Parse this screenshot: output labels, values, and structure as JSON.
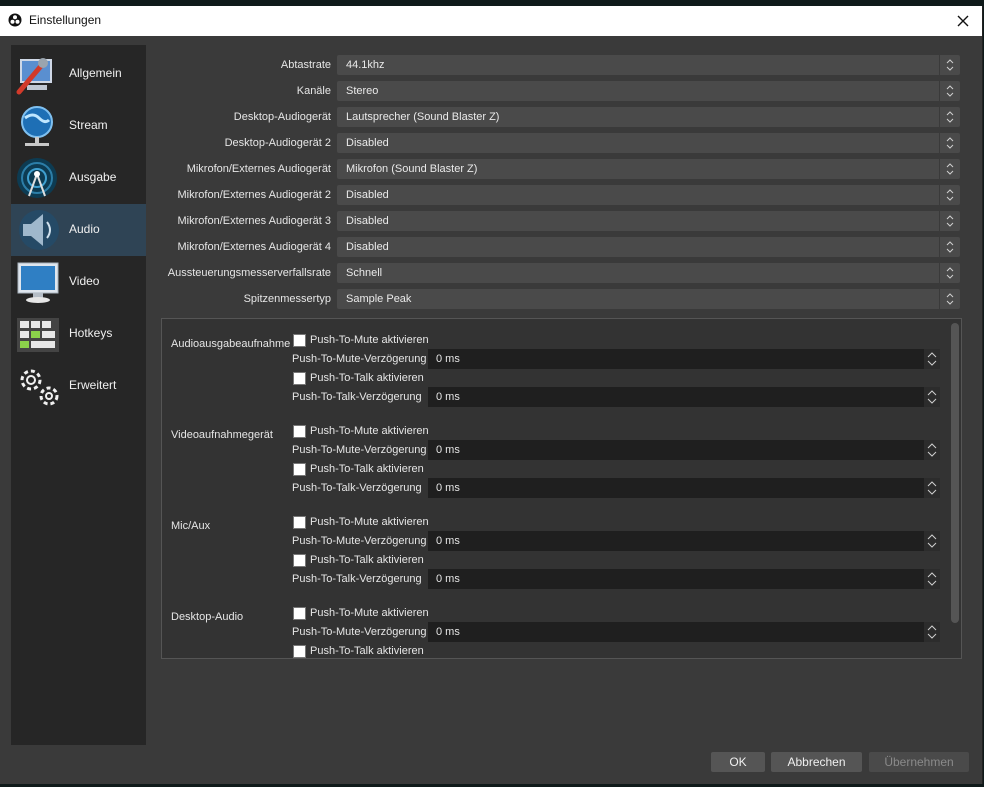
{
  "window": {
    "title": "Einstellungen"
  },
  "sidebar": {
    "items": [
      {
        "label": "Allgemein",
        "icon": "wrench-computer-icon"
      },
      {
        "label": "Stream",
        "icon": "globe-network-icon"
      },
      {
        "label": "Ausgabe",
        "icon": "broadcast-antenna-icon"
      },
      {
        "label": "Audio",
        "icon": "speaker-icon",
        "active": true
      },
      {
        "label": "Video",
        "icon": "monitor-icon"
      },
      {
        "label": "Hotkeys",
        "icon": "keyboard-icon"
      },
      {
        "label": "Erweitert",
        "icon": "gears-icon"
      }
    ]
  },
  "audio": {
    "fields": [
      {
        "label": "Abtastrate",
        "value": "44.1khz"
      },
      {
        "label": "Kanäle",
        "value": "Stereo"
      },
      {
        "label": "Desktop-Audiogerät",
        "value": "Lautsprecher (Sound Blaster Z)"
      },
      {
        "label": "Desktop-Audiogerät 2",
        "value": "Disabled"
      },
      {
        "label": "Mikrofon/Externes Audiogerät",
        "value": "Mikrofon (Sound Blaster Z)"
      },
      {
        "label": "Mikrofon/Externes Audiogerät 2",
        "value": "Disabled"
      },
      {
        "label": "Mikrofon/Externes Audiogerät 3",
        "value": "Disabled"
      },
      {
        "label": "Mikrofon/Externes Audiogerät 4",
        "value": "Disabled"
      },
      {
        "label": "Aussteuerungsmesserverfallsrate",
        "value": "Schnell"
      },
      {
        "label": "Spitzenmessertyp",
        "value": "Sample Peak"
      }
    ]
  },
  "hotkeys": {
    "groups": [
      {
        "name": "Audioausgabeaufnahme",
        "mute_check": "Push-To-Mute aktivieren",
        "mute_delay_label": "Push-To-Mute-Verzögerung",
        "mute_delay": "0 ms",
        "talk_check": "Push-To-Talk aktivieren",
        "talk_delay_label": "Push-To-Talk-Verzögerung",
        "talk_delay": "0 ms"
      },
      {
        "name": "Videoaufnahmegerät",
        "mute_check": "Push-To-Mute aktivieren",
        "mute_delay_label": "Push-To-Mute-Verzögerung",
        "mute_delay": "0 ms",
        "talk_check": "Push-To-Talk aktivieren",
        "talk_delay_label": "Push-To-Talk-Verzögerung",
        "talk_delay": "0 ms"
      },
      {
        "name": "Mic/Aux",
        "mute_check": "Push-To-Mute aktivieren",
        "mute_delay_label": "Push-To-Mute-Verzögerung",
        "mute_delay": "0 ms",
        "talk_check": "Push-To-Talk aktivieren",
        "talk_delay_label": "Push-To-Talk-Verzögerung",
        "talk_delay": "0 ms"
      },
      {
        "name": "Desktop-Audio",
        "mute_check": "Push-To-Mute aktivieren",
        "mute_delay_label": "Push-To-Mute-Verzögerung",
        "mute_delay": "0 ms",
        "talk_check": "Push-To-Talk aktivieren"
      }
    ]
  },
  "buttons": {
    "ok": "OK",
    "cancel": "Abbrechen",
    "apply": "Übernehmen"
  }
}
